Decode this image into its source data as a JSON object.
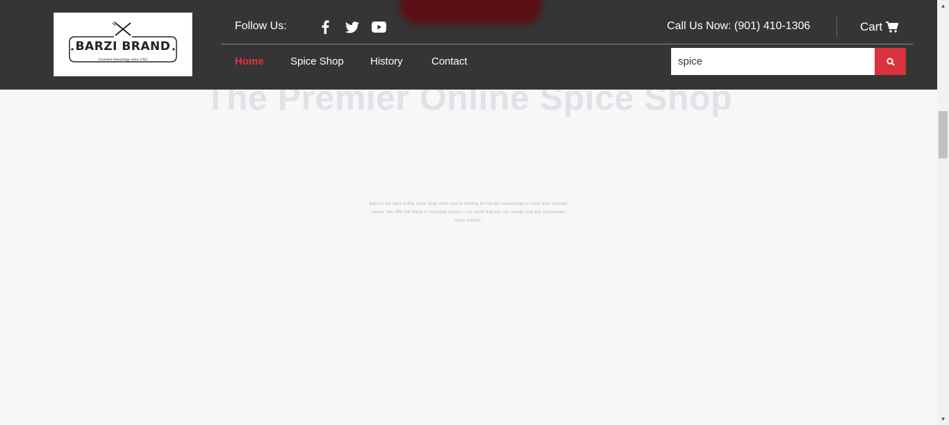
{
  "brand": {
    "name": "BARZI BRAND",
    "tagline": "Gourmet Seasonings since 1925"
  },
  "header": {
    "follow_label": "Follow Us:",
    "social": [
      "facebook-icon",
      "twitter-icon",
      "youtube-icon"
    ],
    "call_label": "Call Us Now: (901) 410-1306",
    "cart_label": "Cart"
  },
  "nav": {
    "items": [
      {
        "label": "Home",
        "active": true
      },
      {
        "label": "Spice Shop",
        "active": false
      },
      {
        "label": "History",
        "active": false
      },
      {
        "label": "Contact",
        "active": false
      }
    ]
  },
  "search": {
    "value": "spice"
  },
  "hero": {
    "title": "The Premier Online Spice Shop",
    "text": "Barzi is the best online spice shop when you're looking for top tier seasonings to meet your culinary needs. We offer the finest in imported spices — so much that we can readily rival any Indonesian spice market."
  },
  "colors": {
    "header_bg": "#353535",
    "accent": "#d9333f",
    "page_bg": "#f7f7f9"
  }
}
